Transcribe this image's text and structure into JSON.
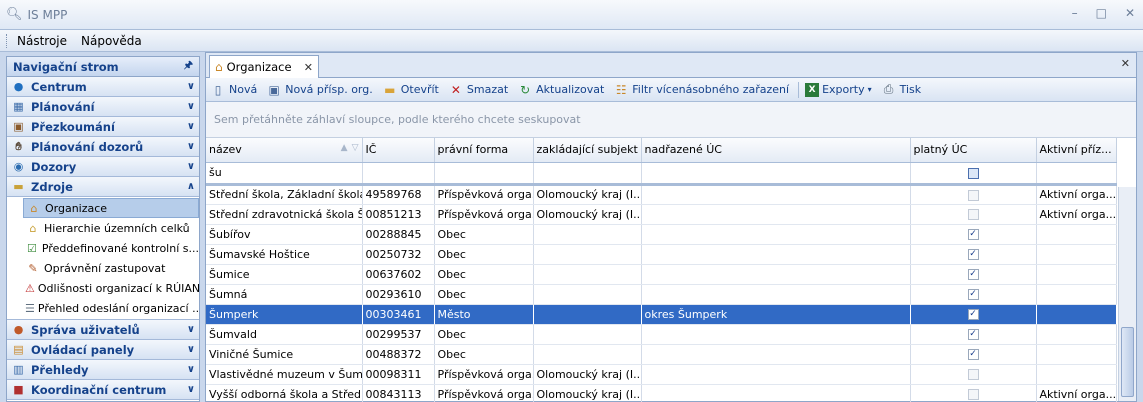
{
  "app": {
    "title": "IS MPP"
  },
  "menu": {
    "items": [
      "Nástroje",
      "Nápověda"
    ]
  },
  "nav": {
    "header": "Navigační strom",
    "groups_top": [
      {
        "label": "Centrum",
        "icon": "globe-icon"
      },
      {
        "label": "Plánování",
        "icon": "calendar-icon"
      },
      {
        "label": "Přezkoumání",
        "icon": "magnifier-icon"
      },
      {
        "label": "Plánování dozorů",
        "icon": "handshake-icon"
      },
      {
        "label": "Dozory",
        "icon": "eye-icon"
      },
      {
        "label": "Zdroje",
        "icon": "folder-icon"
      }
    ],
    "zdroje_items": [
      {
        "label": "Organizace",
        "icon": "house-icon"
      },
      {
        "label": "Hierarchie územních celků",
        "icon": "hierarchy-icon"
      },
      {
        "label": "Předdefinované kontrolní s...",
        "icon": "checklist-icon"
      },
      {
        "label": "Oprávnění zastupovat",
        "icon": "authorization-icon"
      },
      {
        "label": "Odlišnosti organizací k RÚIAN",
        "icon": "warning-icon"
      },
      {
        "label": "Přehled odeslání organizací ...",
        "icon": "document-icon"
      }
    ],
    "groups_bottom": [
      {
        "label": "Správa uživatelů",
        "icon": "users-icon"
      },
      {
        "label": "Ovládací panely",
        "icon": "panel-icon"
      },
      {
        "label": "Přehledy",
        "icon": "report-icon"
      },
      {
        "label": "Koordinační centrum",
        "icon": "coordination-icon"
      }
    ]
  },
  "tab": {
    "label": "Organizace"
  },
  "toolbar": {
    "new": "Nová",
    "new_contrib": "Nová přísp. org.",
    "open": "Otevřít",
    "delete": "Smazat",
    "refresh": "Aktualizovat",
    "filter": "Filtr vícenásobného zařazení",
    "exports": "Exporty",
    "print": "Tisk"
  },
  "group_panel_hint": "Sem přetáhněte záhlaví sloupce, podle kterého chcete seskupovat",
  "grid": {
    "columns": [
      "název",
      "IČ",
      "právní forma",
      "zakládající subjekt",
      "nadřazené ÚC",
      "platný ÚC",
      "Aktivní příz..."
    ],
    "filter_value": "šu",
    "rows": [
      {
        "nazev": "Střední škola, Základní škola...",
        "ic": "49589768",
        "forma": "Příspěvková orga...",
        "zakl": "Olomoucký kraj (I...",
        "nadr": "",
        "platny": false,
        "aktivni": "Aktivní orga..."
      },
      {
        "nazev": "Střední zdravotnická škola Š...",
        "ic": "00851213",
        "forma": "Příspěvková orga...",
        "zakl": "Olomoucký kraj (I...",
        "nadr": "",
        "platny": false,
        "aktivni": "Aktivní orga..."
      },
      {
        "nazev": "Šubířov",
        "ic": "00288845",
        "forma": "Obec",
        "zakl": "",
        "nadr": "",
        "platny": true,
        "aktivni": ""
      },
      {
        "nazev": "Šumavské Hoštice",
        "ic": "00250732",
        "forma": "Obec",
        "zakl": "",
        "nadr": "",
        "platny": true,
        "aktivni": ""
      },
      {
        "nazev": "Šumice",
        "ic": "00637602",
        "forma": "Obec",
        "zakl": "",
        "nadr": "",
        "platny": true,
        "aktivni": ""
      },
      {
        "nazev": "Šumná",
        "ic": "00293610",
        "forma": "Obec",
        "zakl": "",
        "nadr": "",
        "platny": true,
        "aktivni": ""
      },
      {
        "nazev": "Šumperk",
        "ic": "00303461",
        "forma": "Město",
        "zakl": "",
        "nadr": "okres Šumperk",
        "platny": true,
        "aktivni": "",
        "selected": true
      },
      {
        "nazev": "Šumvald",
        "ic": "00299537",
        "forma": "Obec",
        "zakl": "",
        "nadr": "",
        "platny": true,
        "aktivni": ""
      },
      {
        "nazev": "Viničné Šumice",
        "ic": "00488372",
        "forma": "Obec",
        "zakl": "",
        "nadr": "",
        "platny": true,
        "aktivni": ""
      },
      {
        "nazev": "Vlastivědné muzeum v Šump...",
        "ic": "00098311",
        "forma": "Příspěvková orga...",
        "zakl": "Olomoucký kraj (I...",
        "nadr": "",
        "platny": false,
        "aktivni": ""
      },
      {
        "nazev": "Vyšší odborná škola a Střed...",
        "ic": "00843113",
        "forma": "Příspěvková orga...",
        "zakl": "Olomoucký kraj (I...",
        "nadr": "",
        "platny": false,
        "aktivni": "Aktivní orga..."
      }
    ]
  }
}
